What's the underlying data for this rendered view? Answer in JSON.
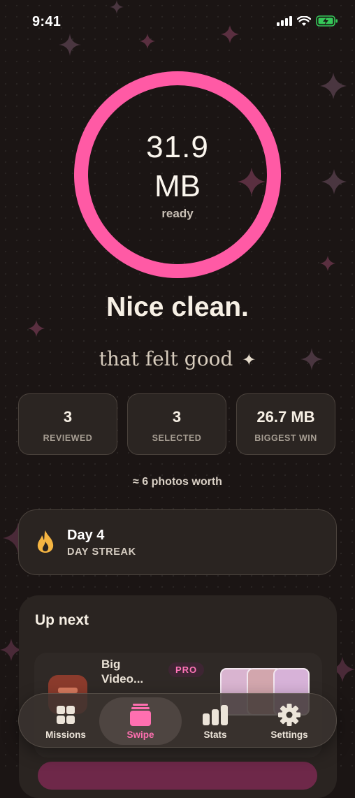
{
  "status_bar": {
    "time": "9:41"
  },
  "summary": {
    "ring_value": "31.9",
    "ring_unit": "MB",
    "ring_caption": "ready",
    "ring_progress": 1.0,
    "headline": "Nice clean.",
    "subhead": "that felt good",
    "sparkle": "✦"
  },
  "stats": [
    {
      "value": "3",
      "label": "REVIEWED"
    },
    {
      "value": "3",
      "label": "SELECTED"
    },
    {
      "value": "26.7 MB",
      "label": "BIGGEST WIN"
    }
  ],
  "equivalence": "≈ 6 photos worth",
  "streak": {
    "title": "Day 4",
    "subtitle": "DAY STREAK",
    "icon": "flame-icon"
  },
  "up_next": {
    "title": "Up next",
    "item": {
      "title": "Big Video...",
      "badge": "PRO",
      "icon": "video-icon"
    }
  },
  "tabs": [
    {
      "label": "Missions",
      "icon": "grid-icon",
      "active": false
    },
    {
      "label": "Swipe",
      "icon": "cards-icon",
      "active": true
    },
    {
      "label": "Stats",
      "icon": "bar-chart-icon",
      "active": false
    },
    {
      "label": "Settings",
      "icon": "gear-icon",
      "active": false
    }
  ],
  "colors": {
    "background": "#1b1514",
    "accent_pink": "#ff5aa5",
    "card": "#2b2522",
    "flame": "#f5b542"
  }
}
